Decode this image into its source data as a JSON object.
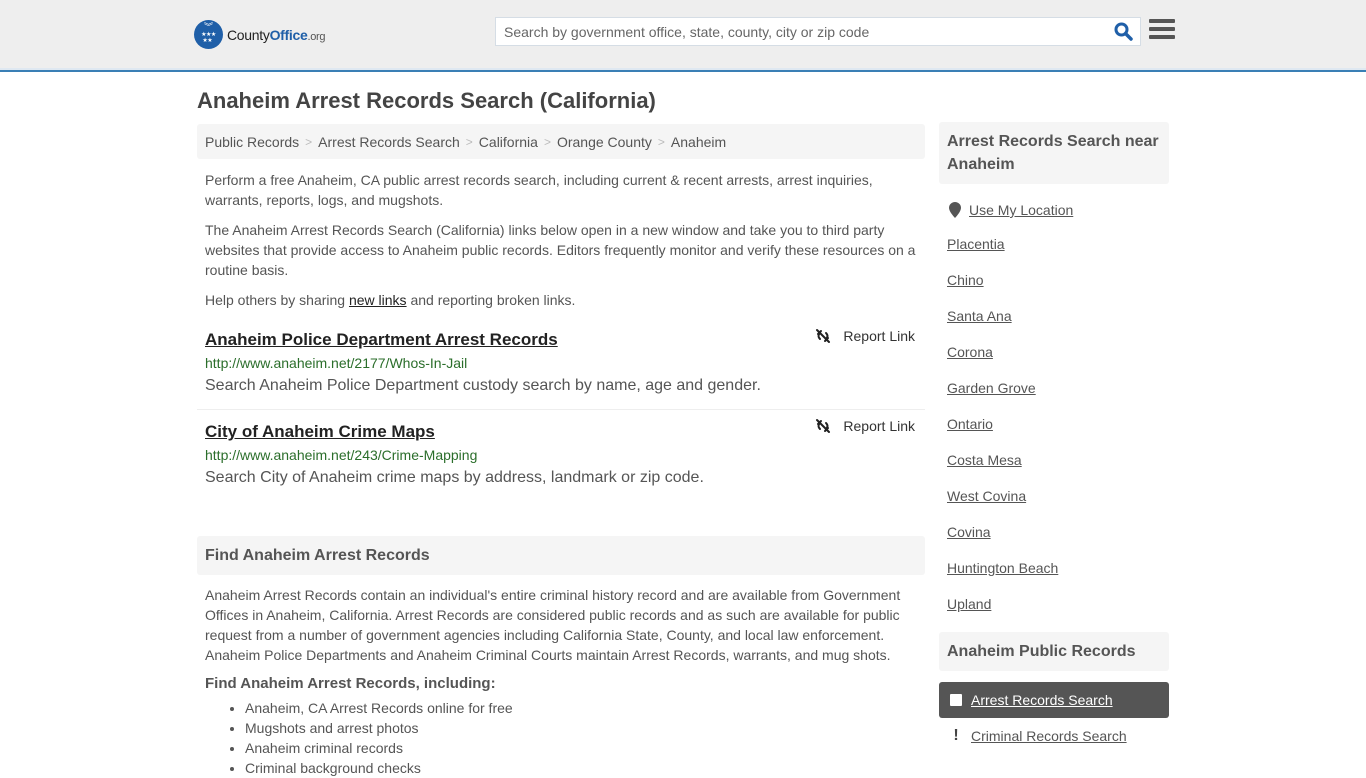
{
  "header": {
    "logo": {
      "name_part1": "County",
      "name_part2": "Office",
      "tld": ".org"
    },
    "search": {
      "placeholder": "Search by government office, state, county, city or zip code",
      "value": ""
    },
    "colors": {
      "accent": "#1f5fa8",
      "header_border": "#3a7fb5"
    }
  },
  "page": {
    "title": "Anaheim Arrest Records Search (California)",
    "breadcrumb": [
      "Public Records",
      "Arrest Records Search",
      "California",
      "Orange County",
      "Anaheim"
    ],
    "intro": {
      "p1": "Perform a free Anaheim, CA public arrest records search, including current & recent arrests, arrest inquiries, warrants, reports, logs, and mugshots.",
      "p2": "The Anaheim Arrest Records Search (California) links below open in a new window and take you to third party websites that provide access to Anaheim public records. Editors frequently monitor and verify these resources on a routine basis.",
      "p3_before": "Help others by sharing ",
      "p3_link": "new links",
      "p3_after": " and reporting broken links."
    },
    "resources": [
      {
        "title": "Anaheim Police Department Arrest Records",
        "url": "http://www.anaheim.net/2177/Whos-In-Jail",
        "description": "Search Anaheim Police Department custody search by name, age and gender.",
        "report_label": "Report Link"
      },
      {
        "title": "City of Anaheim Crime Maps",
        "url": "http://www.anaheim.net/243/Crime-Mapping",
        "description": "Search City of Anaheim crime maps by address, landmark or zip code.",
        "report_label": "Report Link"
      }
    ],
    "find_section": {
      "heading": "Find Anaheim Arrest Records",
      "body": "Anaheim Arrest Records contain an individual's entire criminal history record and are available from Government Offices in Anaheim, California. Arrest Records are considered public records and as such are available for public request from a number of government agencies including California State, County, and local law enforcement. Anaheim Police Departments and Anaheim Criminal Courts maintain Arrest Records, warrants, and mug shots.",
      "subheading": "Find Anaheim Arrest Records, including:",
      "items": [
        "Anaheim, CA Arrest Records online for free",
        "Mugshots and arrest photos",
        "Anaheim criminal records",
        "Criminal background checks"
      ]
    }
  },
  "sidebar": {
    "near_heading": "Arrest Records Search near Anaheim",
    "use_location": "Use My Location",
    "nearby": [
      "Placentia",
      "Chino",
      "Santa Ana",
      "Corona",
      "Garden Grove",
      "Ontario",
      "Costa Mesa",
      "West Covina",
      "Covina",
      "Huntington Beach",
      "Upland"
    ],
    "public_records_heading": "Anaheim Public Records",
    "public_records": [
      {
        "label": "Arrest Records Search",
        "icon": "checkbox-icon",
        "active": true
      },
      {
        "label": "Criminal Records Search",
        "icon": "exclamation-icon",
        "active": false
      }
    ]
  }
}
